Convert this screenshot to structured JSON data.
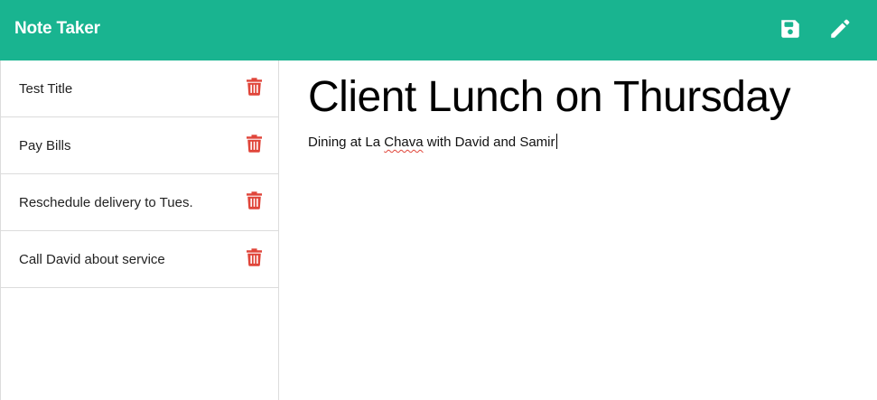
{
  "app": {
    "title": "Note Taker"
  },
  "toolbar": {
    "save_icon": "save-icon",
    "edit_icon": "pencil-icon"
  },
  "colors": {
    "navbar": "#19b490",
    "trash": "#e0453a"
  },
  "notes": [
    {
      "title": "Test Title"
    },
    {
      "title": "Pay Bills"
    },
    {
      "title": "Reschedule delivery to Tues."
    },
    {
      "title": "Call David about service"
    }
  ],
  "active_note": {
    "title": "Client Lunch on Thursday",
    "body_before": "Dining at La ",
    "body_misspelled": "Chava",
    "body_after": " with David and Samir"
  }
}
